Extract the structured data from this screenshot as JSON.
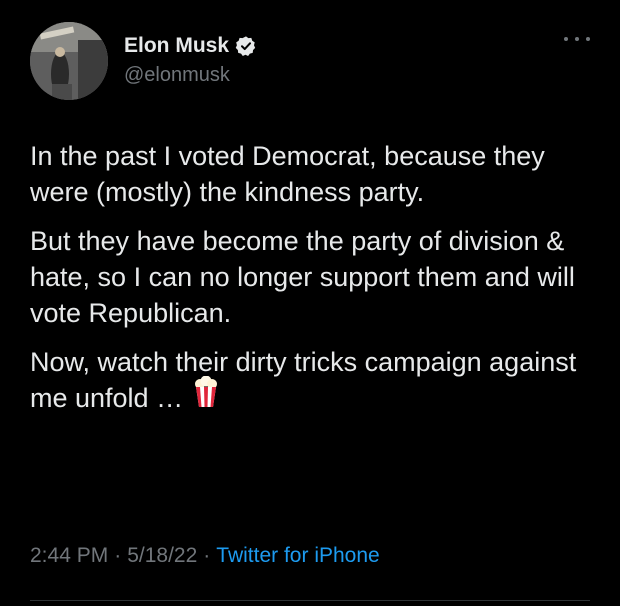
{
  "author": {
    "display_name": "Elon Musk",
    "handle": "@elonmusk",
    "verified_icon": "verified-badge-icon"
  },
  "tweet": {
    "paragraphs": [
      "In the past I voted Democrat, because they were (mostly) the kindness party.",
      "But they have become the party of division & hate, so I can no longer support them and will vote Republican.",
      "Now, watch their dirty tricks campaign against me unfold …"
    ],
    "emoji_icon": "popcorn-icon"
  },
  "meta": {
    "time": "2:44 PM",
    "separator": "·",
    "date": "5/18/22",
    "source": "Twitter for iPhone"
  },
  "colors": {
    "background": "#000000",
    "text": "#e7e9ea",
    "muted": "#71767b",
    "link": "#1d9bf0"
  }
}
